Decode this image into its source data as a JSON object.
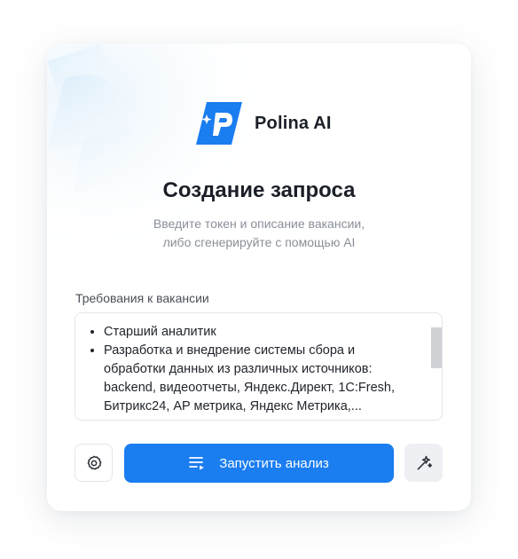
{
  "brand": {
    "name": "Polina AI",
    "logo_icon": "polina-logo",
    "logo_color": "#1a7df0"
  },
  "header": {
    "title": "Создание запроса",
    "subtitle_lines": [
      "Введите токен и описание вакансии,",
      "либо сгенерируйте с помощью AI"
    ]
  },
  "requirements": {
    "label": "Требования к вакансии",
    "items": [
      "Старший аналитик",
      "Разработка и внедрение системы сбора и обработки данных из различных источников: backend, видеоотчеты, Яндекс.Директ, 1C:Fresh, Битрикс24, AP метрика, Яндекс Метрика,..."
    ]
  },
  "actions": {
    "settings_icon": "gear-icon",
    "run_label": "Запустить анализ",
    "run_icon": "list-play-icon",
    "magic_icon": "magic-wand-icon",
    "primary_color": "#1a7df0"
  }
}
